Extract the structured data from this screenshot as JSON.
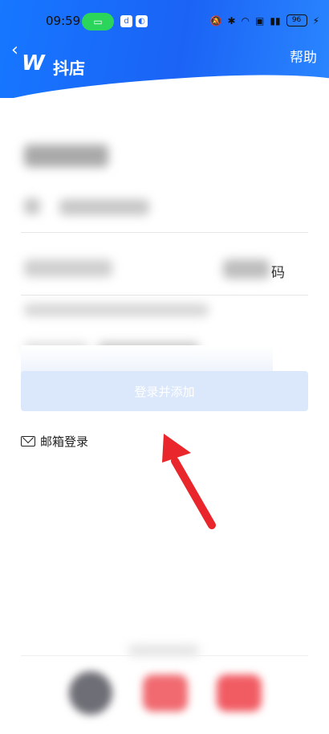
{
  "status_bar": {
    "time": "09:59",
    "battery": "96",
    "icons": [
      "screen-cast-icon",
      "app-doudian-icon",
      "app-blue-icon",
      "mute-icon",
      "bluetooth-icon",
      "wifi-icon",
      "hd-icon",
      "signal-icon",
      "charging-icon"
    ]
  },
  "header": {
    "brand": "抖店",
    "help": "帮助",
    "logo_glyph": "W"
  },
  "form": {
    "code_suffix": "码",
    "submit_label": "登录并添加"
  },
  "alt_login": {
    "email_label": "邮箱登录"
  },
  "colors": {
    "header_blue": "#1677ff",
    "submit_bg": "#dbe8fb",
    "arrow_red": "#e8262b"
  }
}
